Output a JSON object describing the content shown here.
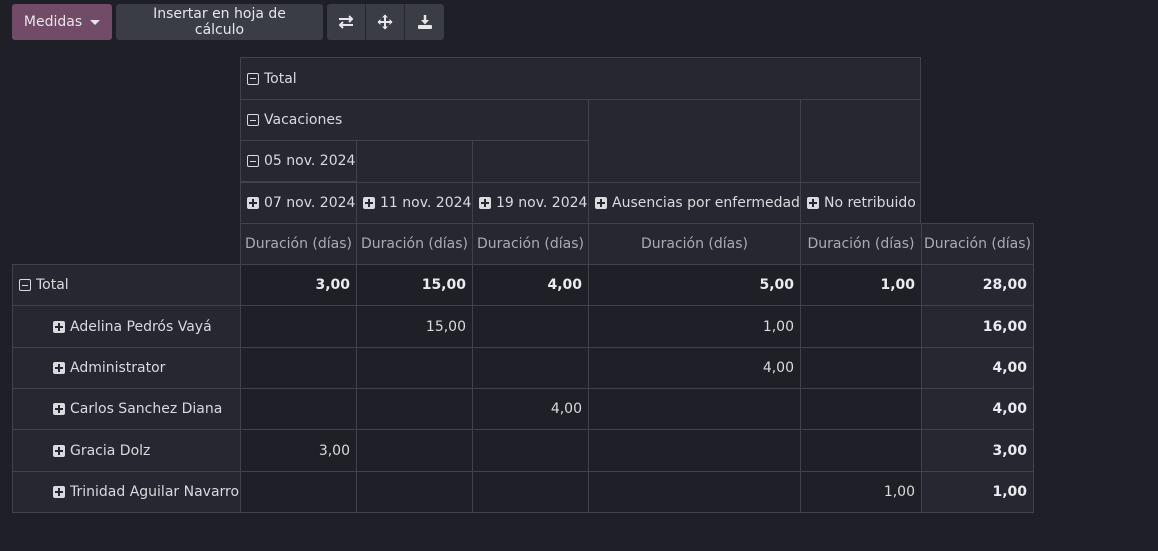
{
  "toolbar": {
    "measures_label": "Medidas",
    "insert_label": "Insertar en hoja de cálculo",
    "icons": [
      "flip-axis-icon",
      "expand-all-icon",
      "download-icon"
    ]
  },
  "pivot": {
    "col_headers": {
      "total": "Total",
      "vacaciones": "Vacaciones",
      "date_group": "05 nov. 2024",
      "d1": "07 nov. 2024",
      "d2": "11 nov. 2024",
      "d3": "19 nov. 2024",
      "sick": "Ausencias por enfermedad",
      "unpaid": "No retribuido"
    },
    "measure": "Duración (días)",
    "rows": [
      {
        "label": "Total",
        "values": [
          "3,00",
          "15,00",
          "4,00",
          "5,00",
          "1,00",
          "28,00"
        ]
      },
      {
        "label": "Adelina Pedrós Vayá",
        "values": [
          "",
          "15,00",
          "",
          "1,00",
          "",
          "16,00"
        ]
      },
      {
        "label": "Administrator",
        "values": [
          "",
          "",
          "",
          "4,00",
          "",
          "4,00"
        ]
      },
      {
        "label": "Carlos Sanchez Diana",
        "values": [
          "",
          "",
          "4,00",
          "",
          "",
          "4,00"
        ]
      },
      {
        "label": "Gracia Dolz",
        "values": [
          "3,00",
          "",
          "",
          "",
          "",
          "3,00"
        ]
      },
      {
        "label": "Trinidad Aguilar Navarro",
        "values": [
          "",
          "",
          "",
          "",
          "1,00",
          "1,00"
        ]
      }
    ]
  },
  "colors": {
    "primary": "#714b67",
    "background": "#1f1f27",
    "header_bg": "#262731"
  }
}
